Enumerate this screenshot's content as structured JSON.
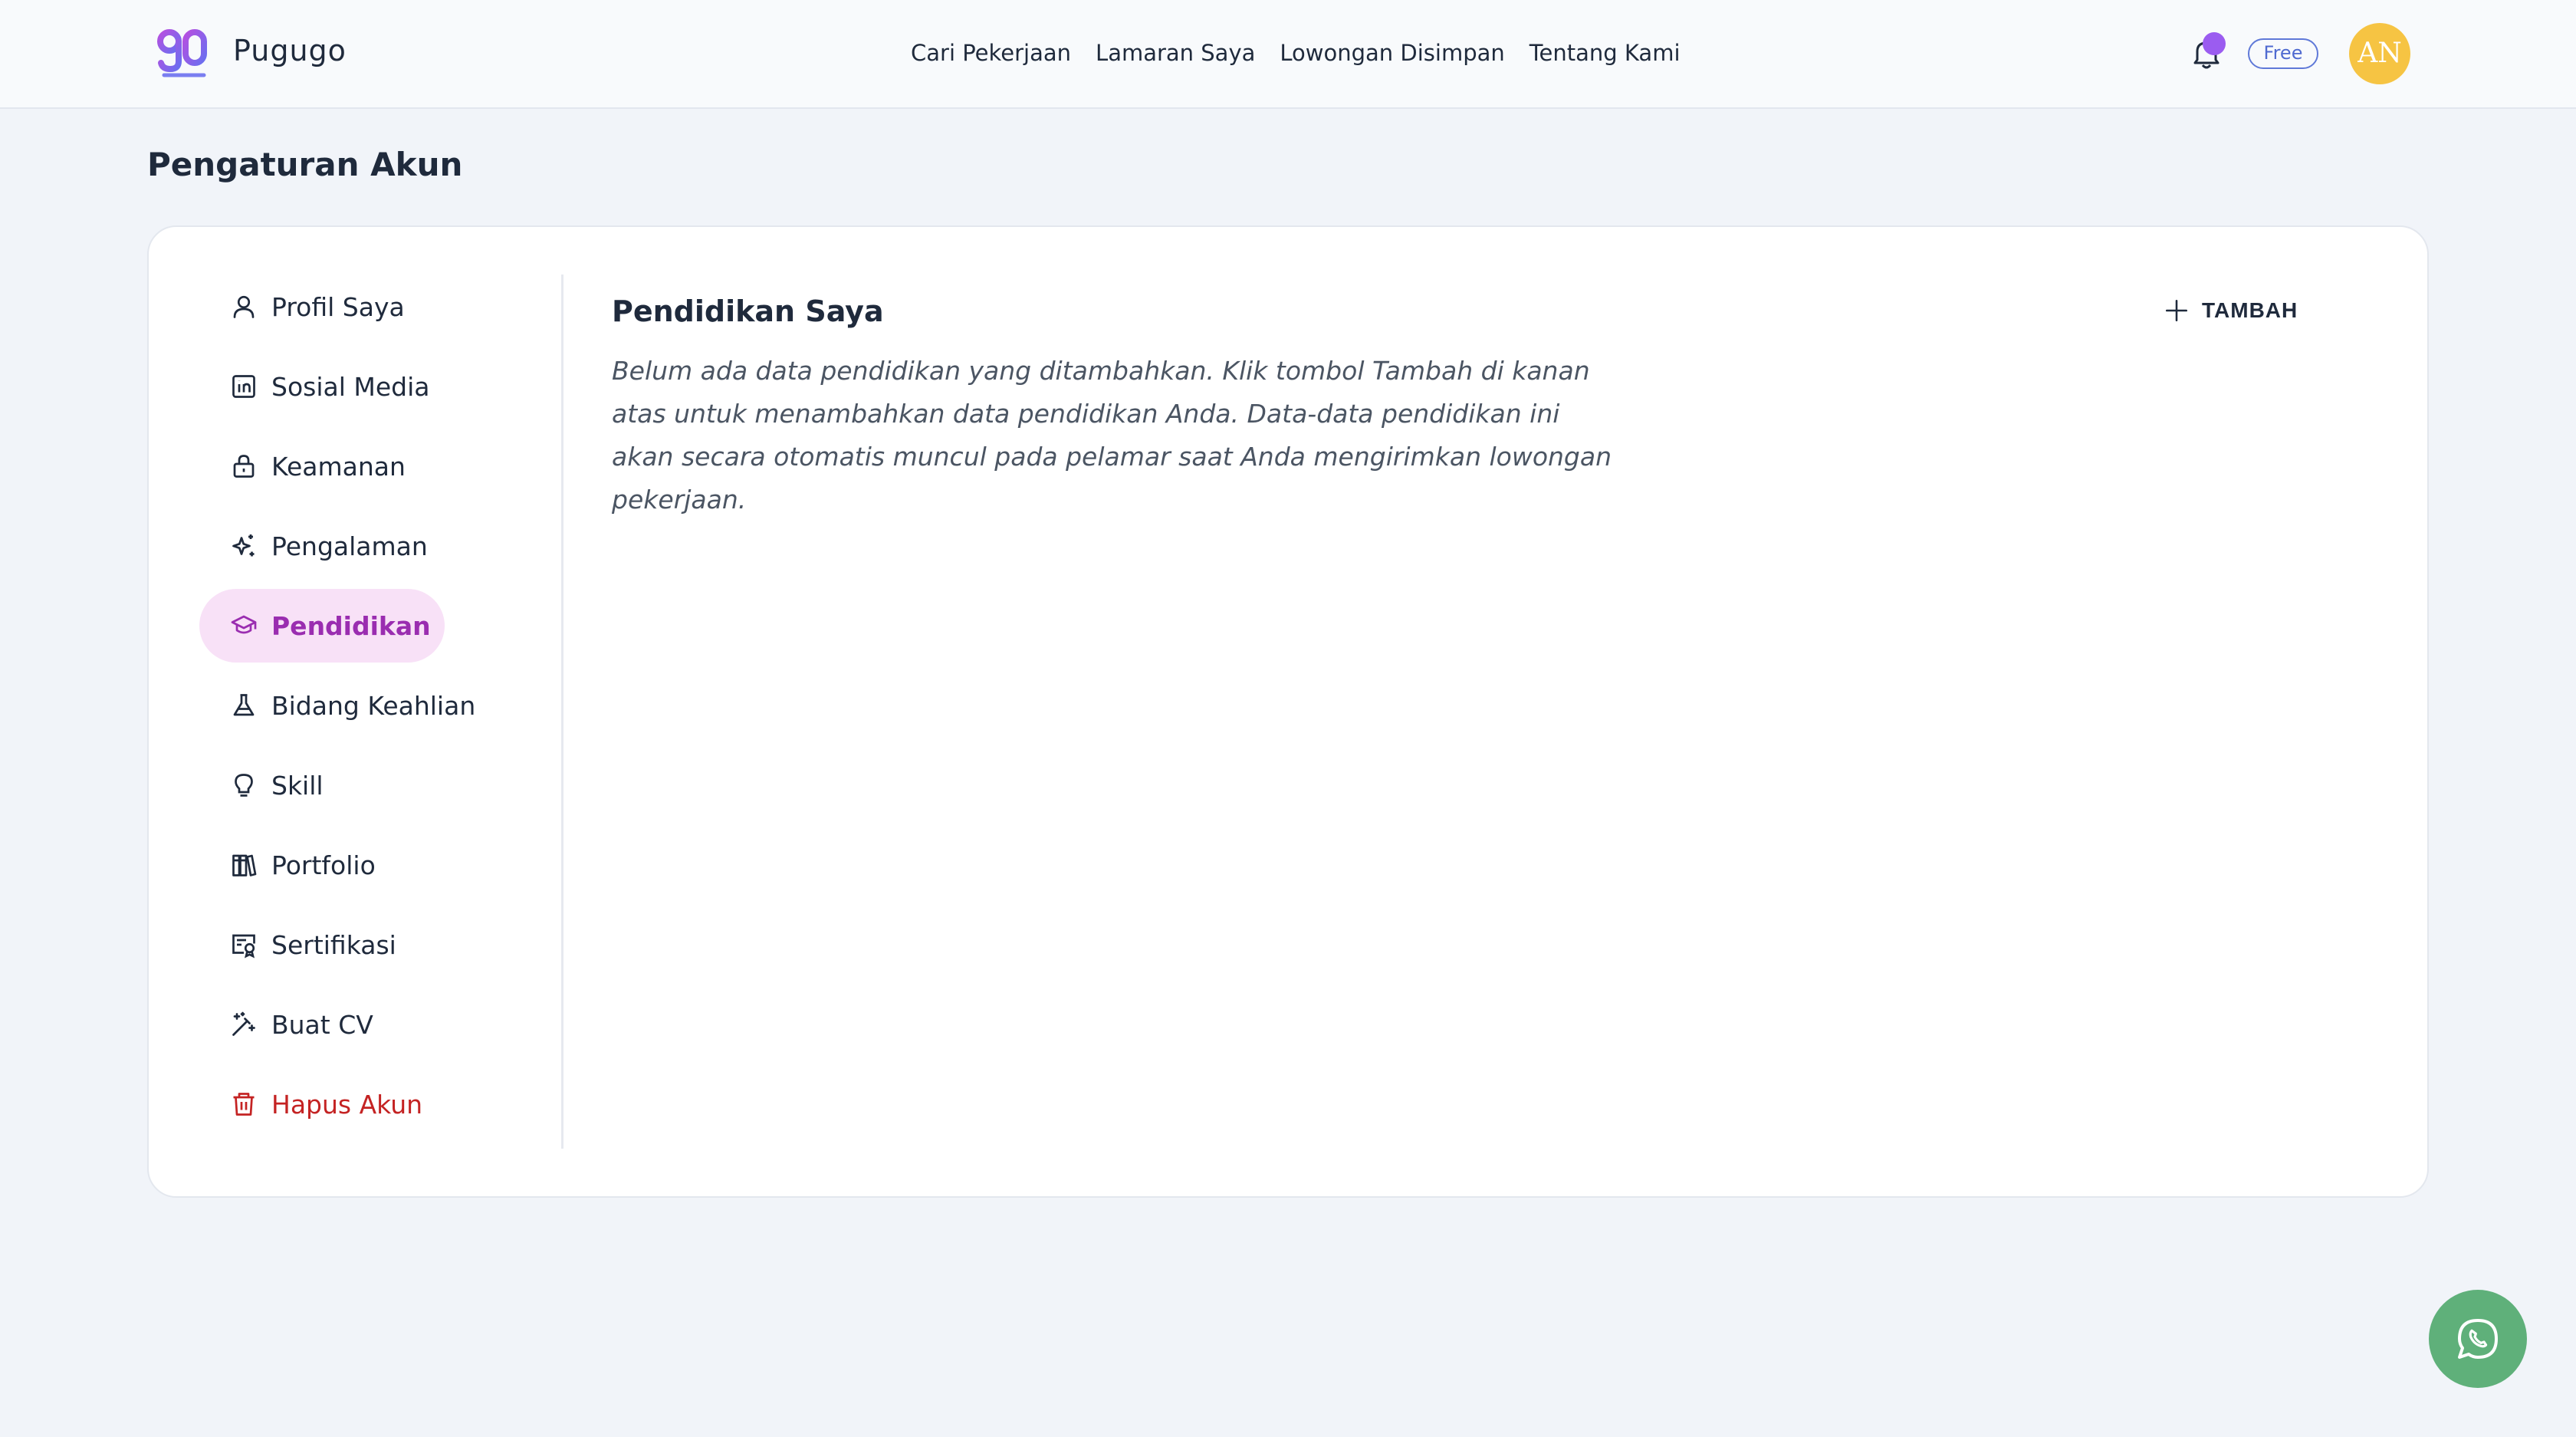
{
  "header": {
    "brand": "Pugugo",
    "nav": [
      "Cari Pekerjaan",
      "Lamaran Saya",
      "Lowongan Disimpan",
      "Tentang Kami"
    ],
    "plan_badge": "Free",
    "avatar_initials": "AN",
    "notification_dot_color": "#9b5cf0",
    "avatar_color": "#f6c443"
  },
  "page_title": "Pengaturan Akun",
  "sidebar": {
    "items": [
      {
        "label": "Profil Saya",
        "icon": "user-icon"
      },
      {
        "label": "Sosial Media",
        "icon": "linkedin-icon"
      },
      {
        "label": "Keamanan",
        "icon": "lock-icon"
      },
      {
        "label": "Pengalaman",
        "icon": "sparkles-icon"
      },
      {
        "label": "Pendidikan",
        "icon": "graduation-cap-icon",
        "active": true
      },
      {
        "label": "Bidang Keahlian",
        "icon": "flask-icon"
      },
      {
        "label": "Skill",
        "icon": "lightbulb-icon"
      },
      {
        "label": "Portfolio",
        "icon": "library-icon"
      },
      {
        "label": "Sertifikasi",
        "icon": "certificate-icon"
      },
      {
        "label": "Buat CV",
        "icon": "magic-wand-icon"
      },
      {
        "label": "Hapus Akun",
        "icon": "trash-icon",
        "danger": true
      }
    ],
    "active_bg": "#f8e1f7",
    "active_color": "#9a2db0",
    "danger_color": "#c42323"
  },
  "content": {
    "title": "Pendidikan Saya",
    "add_label": "TAMBAH",
    "empty_message": "Belum ada data pendidikan yang ditambahkan. Klik tombol Tambah di kanan atas untuk menambahkan data pendidikan Anda. Data-data pendidikan ini akan secara otomatis muncul pada pelamar saat Anda mengirimkan lowongan pekerjaan."
  },
  "floating": {
    "icon": "whatsapp-icon",
    "color": "#5fb07a"
  }
}
